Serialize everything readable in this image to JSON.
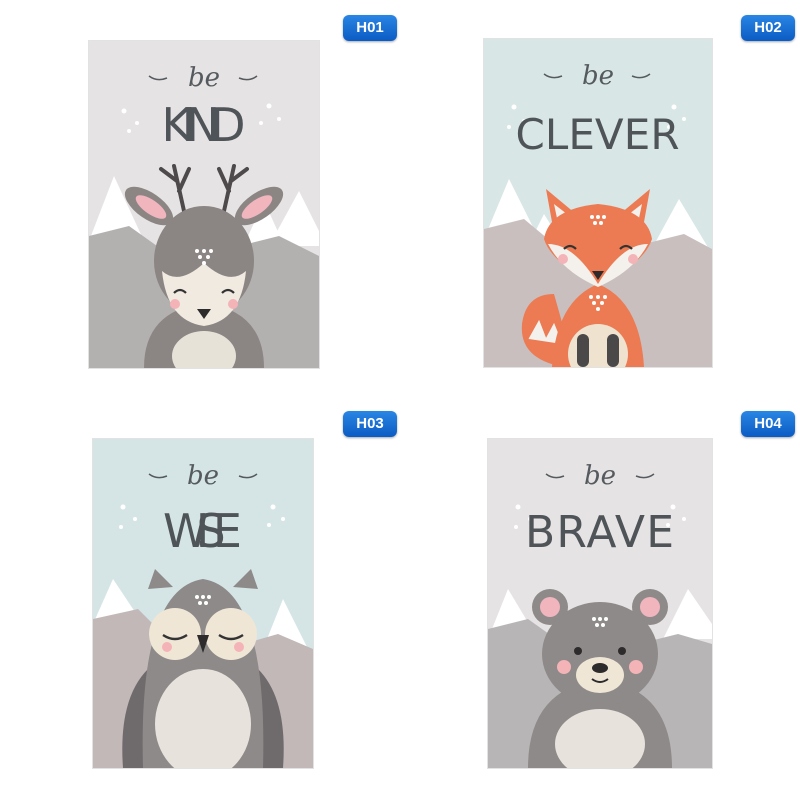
{
  "posters": [
    {
      "code": "H01",
      "prefix": "be",
      "word": "KIND",
      "animal": "deer",
      "background": "#e5e3e3"
    },
    {
      "code": "H02",
      "prefix": "be",
      "word": "CLEVER",
      "animal": "fox",
      "background": "#d9e6e6"
    },
    {
      "code": "H03",
      "prefix": "be",
      "word": "WISE",
      "animal": "owl",
      "background": "#d5e5e5"
    },
    {
      "code": "H04",
      "prefix": "be",
      "word": "BRAVE",
      "animal": "bear",
      "background": "#e6e3e4"
    }
  ],
  "colors": {
    "badge": "#1a6fd6",
    "mountain_dark": "#b3b0b0",
    "mountain_light": "#d6d0cf",
    "snow": "#ffffff",
    "fox_orange": "#ec7a52",
    "animal_grey": "#8d8a89"
  }
}
